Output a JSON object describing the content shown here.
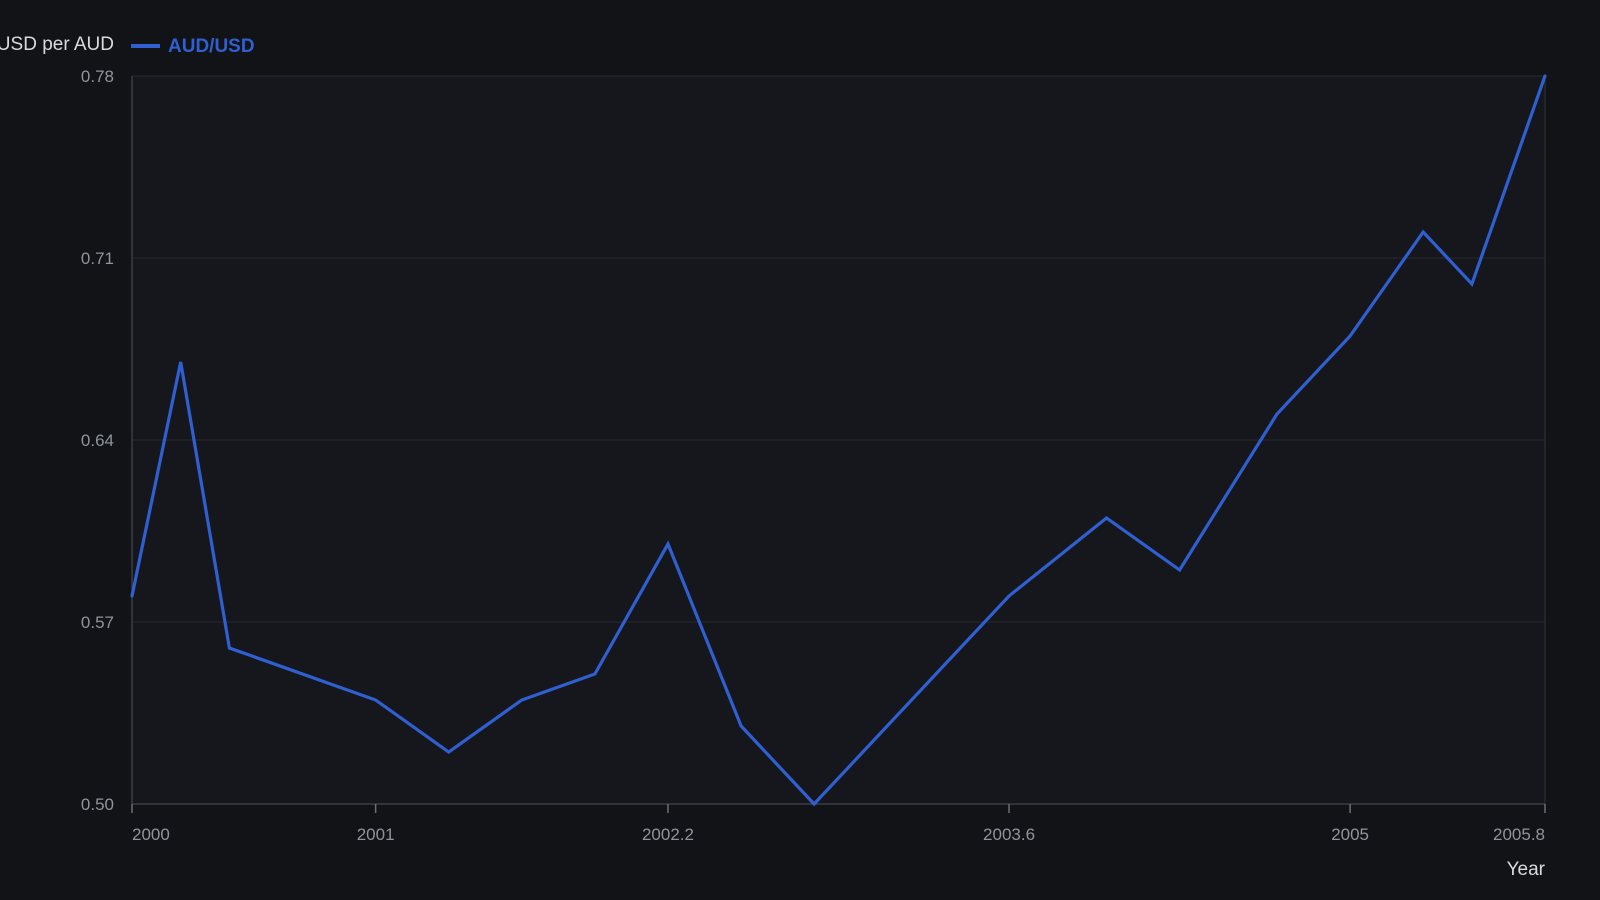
{
  "chart_data": {
    "type": "line",
    "xlabel": "Year",
    "ylabel": "USD per AUD",
    "xlim": [
      2000,
      2005.8
    ],
    "ylim": [
      0.5,
      0.78
    ],
    "x_ticks": [
      2000,
      2001,
      2002.2,
      2003.6,
      2005,
      2005.8
    ],
    "x_tick_labels": [
      "2000",
      "2001",
      "2002.2",
      "2003.6",
      "2005",
      "2005.8"
    ],
    "y_ticks": [
      0.5,
      0.57,
      0.64,
      0.71,
      0.78
    ],
    "y_tick_labels": [
      "0.50",
      "0.57",
      "0.64",
      "0.71",
      "0.78"
    ],
    "grid": true,
    "legend": "top-left",
    "series": [
      {
        "name": "AUD/USD",
        "color": "#2f5fd0",
        "x": [
          2000,
          2000.2,
          2000.4,
          2001,
          2001.3,
          2001.6,
          2001.9,
          2002.2,
          2002.5,
          2002.8,
          2003.1,
          2003.6,
          2004,
          2004.3,
          2004.7,
          2005,
          2005.3,
          2005.5,
          2005.8
        ],
        "y": [
          0.58,
          0.67,
          0.56,
          0.54,
          0.52,
          0.54,
          0.55,
          0.6,
          0.53,
          0.5,
          0.53,
          0.58,
          0.61,
          0.59,
          0.65,
          0.68,
          0.72,
          0.7,
          0.78
        ]
      }
    ]
  }
}
